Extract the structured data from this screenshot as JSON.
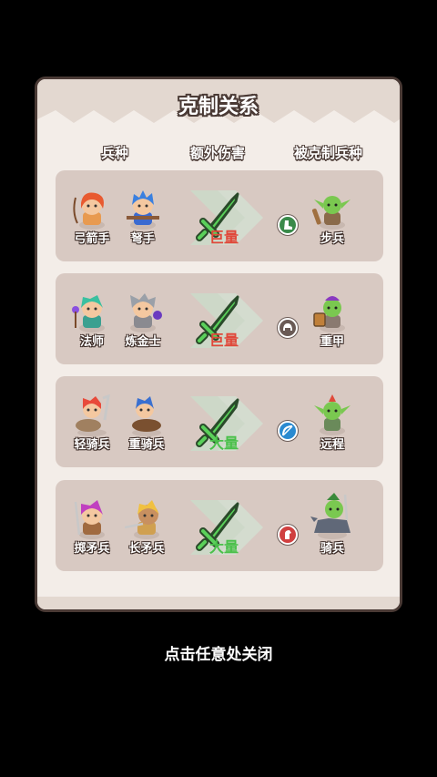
{
  "panel": {
    "title": "克制关系",
    "headers": {
      "unit": "兵种",
      "extra": "额外伤害",
      "countered": "被克制兵种"
    }
  },
  "rows": [
    {
      "units": [
        "弓箭手",
        "弩手"
      ],
      "damage": "巨量",
      "damage_color": "#e0483a",
      "countered": "步兵",
      "icon": "boot-icon",
      "icon_color": "#3a8a4a"
    },
    {
      "units": [
        "法师",
        "炼金士"
      ],
      "damage": "巨量",
      "damage_color": "#e0483a",
      "countered": "重甲",
      "icon": "helmet-icon",
      "icon_color": "#6a5a55"
    },
    {
      "units": [
        "轻骑兵",
        "重骑兵"
      ],
      "damage": "大量",
      "damage_color": "#4ac04a",
      "countered": "远程",
      "icon": "bow-icon",
      "icon_color": "#2a8ad0"
    },
    {
      "units": [
        "掷矛兵",
        "长矛兵"
      ],
      "damage": "大量",
      "damage_color": "#4ac04a",
      "countered": "骑兵",
      "icon": "horse-icon",
      "icon_color": "#d04040"
    }
  ],
  "footer": {
    "hint": "点击任意处关闭"
  }
}
